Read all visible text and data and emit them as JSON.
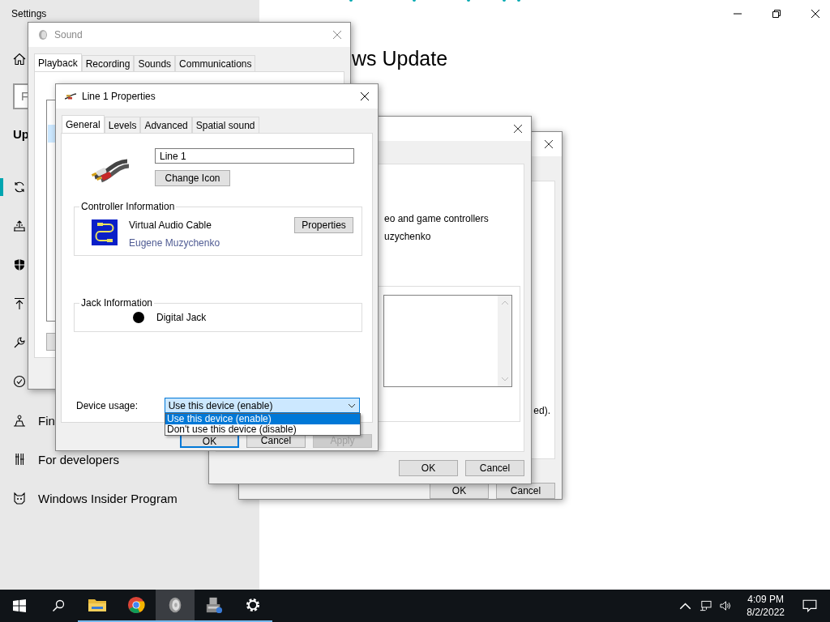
{
  "settings": {
    "title": "Settings",
    "heading": "ws Update",
    "search": {
      "placeholder": "F"
    },
    "section_heading": "Up",
    "nav": [
      {
        "selected": true
      },
      {
        "selected": false
      },
      {
        "selected": false
      },
      {
        "selected": false
      },
      {
        "selected": false
      },
      {
        "selected": false
      },
      {
        "label": "Fin",
        "selected": false
      },
      {
        "label": "For developers",
        "selected": false
      },
      {
        "label": "Windows Insider Program",
        "selected": false
      }
    ]
  },
  "back_dialog": {
    "note": "ed).",
    "buttons": [
      "OK",
      "Cancel"
    ]
  },
  "middle_dialog": {
    "lines": [
      "eo and game controllers",
      "uzychenko"
    ],
    "buttons": [
      "OK",
      "Cancel"
    ]
  },
  "sound_dialog": {
    "title": "Sound",
    "tabs": [
      {
        "label": "Playback",
        "selected": true
      },
      {
        "label": "Recording",
        "selected": false
      },
      {
        "label": "Sounds",
        "selected": false
      },
      {
        "label": "Communications",
        "selected": false
      }
    ]
  },
  "properties_dialog": {
    "title": "Line 1 Properties",
    "tabs": [
      {
        "label": "General",
        "selected": true
      },
      {
        "label": "Levels",
        "selected": false
      },
      {
        "label": "Advanced",
        "selected": false
      },
      {
        "label": "Spatial sound",
        "selected": false
      }
    ],
    "name": "Line 1",
    "change_icon": "Change Icon",
    "controller": {
      "legend": "Controller Information",
      "name": "Virtual Audio Cable",
      "vendor": "Eugene Muzychenko",
      "button": "Properties"
    },
    "jack": {
      "legend": "Jack Information",
      "name": "Digital Jack",
      "color": "#000000"
    },
    "device_usage": {
      "label": "Device usage:",
      "value": "Use this device (enable)",
      "expanded": true,
      "options": [
        {
          "label": "Use this device (enable)",
          "selected": true
        },
        {
          "label": "Don't use this device (disable)",
          "selected": false
        }
      ]
    },
    "buttons": [
      {
        "label": "OK",
        "default": true,
        "disabled": false
      },
      {
        "label": "Cancel",
        "default": false,
        "disabled": false
      },
      {
        "label": "Apply",
        "default": false,
        "disabled": true
      }
    ]
  },
  "taskbar": {
    "apps": [
      {
        "kind": "folder",
        "running": true,
        "active": false
      },
      {
        "kind": "browser",
        "running": true,
        "active": false
      },
      {
        "kind": "speaker",
        "running": true,
        "active": true
      },
      {
        "kind": "device",
        "running": true,
        "active": false
      },
      {
        "kind": "gear",
        "running": true,
        "active": false
      }
    ],
    "time": "4:09 PM",
    "date": "8/2/2022"
  }
}
